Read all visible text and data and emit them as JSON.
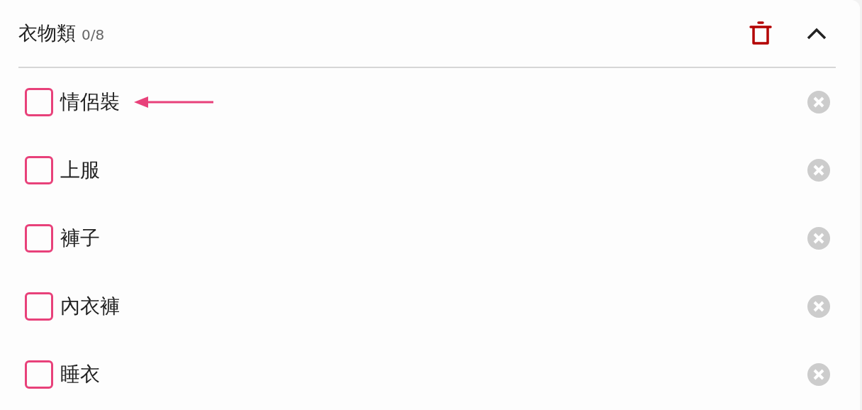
{
  "category": {
    "title": "衣物類",
    "count": "0/8",
    "expanded": true
  },
  "items": [
    {
      "label": "情侶裝",
      "checked": false,
      "marked": true
    },
    {
      "label": "上服",
      "checked": false,
      "marked": false
    },
    {
      "label": "褲子",
      "checked": false,
      "marked": false
    },
    {
      "label": "內衣褲",
      "checked": false,
      "marked": false
    },
    {
      "label": "睡衣",
      "checked": false,
      "marked": false
    }
  ]
}
